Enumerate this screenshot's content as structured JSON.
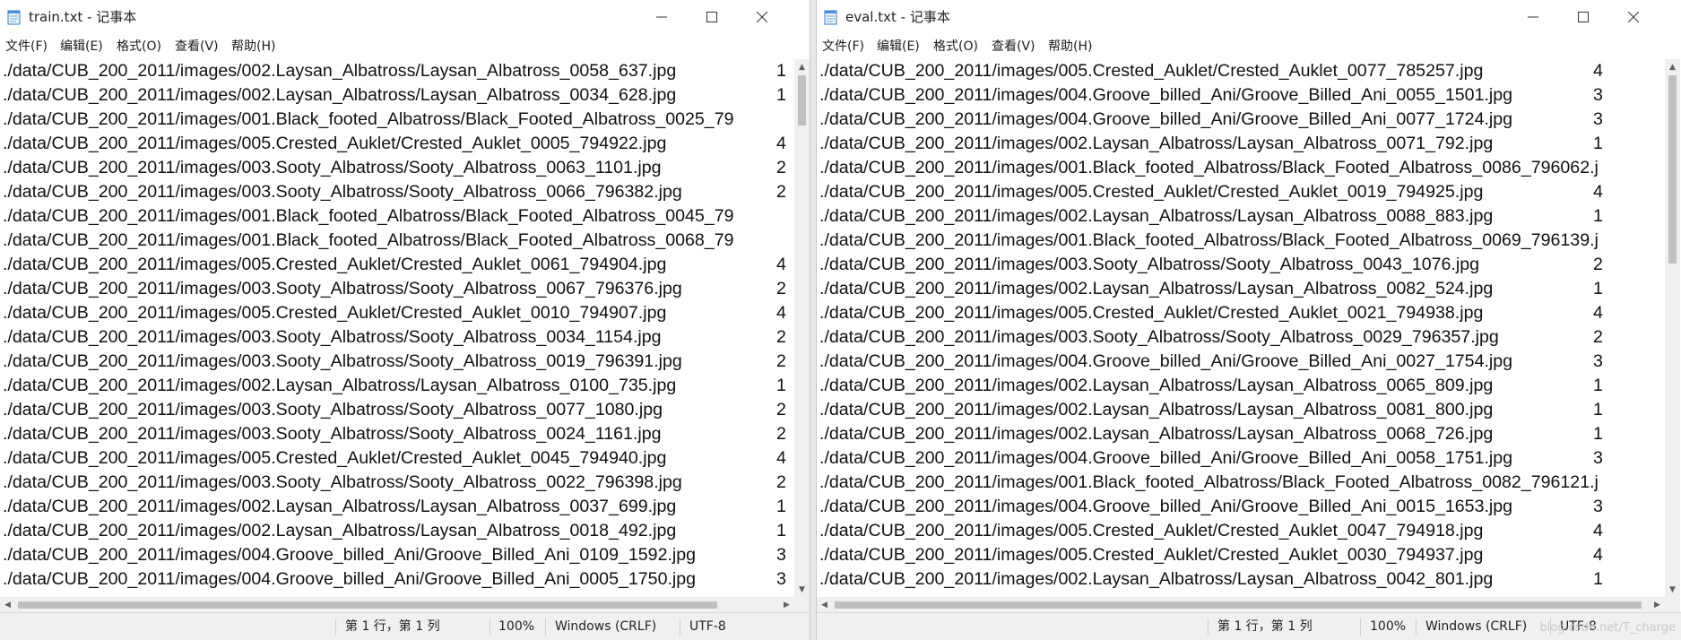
{
  "left": {
    "title": "train.txt - 记事本",
    "menu": [
      "文件(F)",
      "编辑(E)",
      "格式(O)",
      "查看(V)",
      "帮助(H)"
    ],
    "lines": [
      {
        "path": "./data/CUB_200_2011/images/002.Laysan_Albatross/Laysan_Albatross_0058_637.jpg",
        "label": "1"
      },
      {
        "path": "./data/CUB_200_2011/images/002.Laysan_Albatross/Laysan_Albatross_0034_628.jpg",
        "label": "1"
      },
      {
        "path": "./data/CUB_200_2011/images/001.Black_footed_Albatross/Black_Footed_Albatross_0025_79",
        "label": ""
      },
      {
        "path": "./data/CUB_200_2011/images/005.Crested_Auklet/Crested_Auklet_0005_794922.jpg",
        "label": "4"
      },
      {
        "path": "./data/CUB_200_2011/images/003.Sooty_Albatross/Sooty_Albatross_0063_1101.jpg",
        "label": "2"
      },
      {
        "path": "./data/CUB_200_2011/images/003.Sooty_Albatross/Sooty_Albatross_0066_796382.jpg",
        "label": "2"
      },
      {
        "path": "./data/CUB_200_2011/images/001.Black_footed_Albatross/Black_Footed_Albatross_0045_79",
        "label": ""
      },
      {
        "path": "./data/CUB_200_2011/images/001.Black_footed_Albatross/Black_Footed_Albatross_0068_79",
        "label": ""
      },
      {
        "path": "./data/CUB_200_2011/images/005.Crested_Auklet/Crested_Auklet_0061_794904.jpg",
        "label": "4"
      },
      {
        "path": "./data/CUB_200_2011/images/003.Sooty_Albatross/Sooty_Albatross_0067_796376.jpg",
        "label": "2"
      },
      {
        "path": "./data/CUB_200_2011/images/005.Crested_Auklet/Crested_Auklet_0010_794907.jpg",
        "label": "4"
      },
      {
        "path": "./data/CUB_200_2011/images/003.Sooty_Albatross/Sooty_Albatross_0034_1154.jpg",
        "label": "2"
      },
      {
        "path": "./data/CUB_200_2011/images/003.Sooty_Albatross/Sooty_Albatross_0019_796391.jpg",
        "label": "2"
      },
      {
        "path": "./data/CUB_200_2011/images/002.Laysan_Albatross/Laysan_Albatross_0100_735.jpg",
        "label": "1"
      },
      {
        "path": "./data/CUB_200_2011/images/003.Sooty_Albatross/Sooty_Albatross_0077_1080.jpg",
        "label": "2"
      },
      {
        "path": "./data/CUB_200_2011/images/003.Sooty_Albatross/Sooty_Albatross_0024_1161.jpg",
        "label": "2"
      },
      {
        "path": "./data/CUB_200_2011/images/005.Crested_Auklet/Crested_Auklet_0045_794940.jpg",
        "label": "4"
      },
      {
        "path": "./data/CUB_200_2011/images/003.Sooty_Albatross/Sooty_Albatross_0022_796398.jpg",
        "label": "2"
      },
      {
        "path": "./data/CUB_200_2011/images/002.Laysan_Albatross/Laysan_Albatross_0037_699.jpg",
        "label": "1"
      },
      {
        "path": "./data/CUB_200_2011/images/002.Laysan_Albatross/Laysan_Albatross_0018_492.jpg",
        "label": "1"
      },
      {
        "path": "./data/CUB_200_2011/images/004.Groove_billed_Ani/Groove_Billed_Ani_0109_1592.jpg",
        "label": "3"
      },
      {
        "path": "./data/CUB_200_2011/images/004.Groove_billed_Ani/Groove_Billed_Ani_0005_1750.jpg",
        "label": "3"
      }
    ],
    "status": {
      "position": "第 1 行，第 1 列",
      "zoom": "100%",
      "eol": "Windows (CRLF)",
      "encoding": "UTF-8"
    }
  },
  "right": {
    "title": "eval.txt - 记事本",
    "menu": [
      "文件(F)",
      "编辑(E)",
      "格式(O)",
      "查看(V)",
      "帮助(H)"
    ],
    "lines": [
      {
        "path": "./data/CUB_200_2011/images/005.Crested_Auklet/Crested_Auklet_0077_785257.jpg",
        "label": "4"
      },
      {
        "path": "./data/CUB_200_2011/images/004.Groove_billed_Ani/Groove_Billed_Ani_0055_1501.jpg",
        "label": "3"
      },
      {
        "path": "./data/CUB_200_2011/images/004.Groove_billed_Ani/Groove_Billed_Ani_0077_1724.jpg",
        "label": "3"
      },
      {
        "path": "./data/CUB_200_2011/images/002.Laysan_Albatross/Laysan_Albatross_0071_792.jpg",
        "label": "1"
      },
      {
        "path": "./data/CUB_200_2011/images/001.Black_footed_Albatross/Black_Footed_Albatross_0086_796062.j",
        "label": ""
      },
      {
        "path": "./data/CUB_200_2011/images/005.Crested_Auklet/Crested_Auklet_0019_794925.jpg",
        "label": "4"
      },
      {
        "path": "./data/CUB_200_2011/images/002.Laysan_Albatross/Laysan_Albatross_0088_883.jpg",
        "label": "1"
      },
      {
        "path": "./data/CUB_200_2011/images/001.Black_footed_Albatross/Black_Footed_Albatross_0069_796139.j",
        "label": ""
      },
      {
        "path": "./data/CUB_200_2011/images/003.Sooty_Albatross/Sooty_Albatross_0043_1076.jpg",
        "label": "2"
      },
      {
        "path": "./data/CUB_200_2011/images/002.Laysan_Albatross/Laysan_Albatross_0082_524.jpg",
        "label": "1"
      },
      {
        "path": "./data/CUB_200_2011/images/005.Crested_Auklet/Crested_Auklet_0021_794938.jpg",
        "label": "4"
      },
      {
        "path": "./data/CUB_200_2011/images/003.Sooty_Albatross/Sooty_Albatross_0029_796357.jpg",
        "label": "2"
      },
      {
        "path": "./data/CUB_200_2011/images/004.Groove_billed_Ani/Groove_Billed_Ani_0027_1754.jpg",
        "label": "3"
      },
      {
        "path": "./data/CUB_200_2011/images/002.Laysan_Albatross/Laysan_Albatross_0065_809.jpg",
        "label": "1"
      },
      {
        "path": "./data/CUB_200_2011/images/002.Laysan_Albatross/Laysan_Albatross_0081_800.jpg",
        "label": "1"
      },
      {
        "path": "./data/CUB_200_2011/images/002.Laysan_Albatross/Laysan_Albatross_0068_726.jpg",
        "label": "1"
      },
      {
        "path": "./data/CUB_200_2011/images/004.Groove_billed_Ani/Groove_Billed_Ani_0058_1751.jpg",
        "label": "3"
      },
      {
        "path": "./data/CUB_200_2011/images/001.Black_footed_Albatross/Black_Footed_Albatross_0082_796121.j",
        "label": ""
      },
      {
        "path": "./data/CUB_200_2011/images/004.Groove_billed_Ani/Groove_Billed_Ani_0015_1653.jpg",
        "label": "3"
      },
      {
        "path": "./data/CUB_200_2011/images/005.Crested_Auklet/Crested_Auklet_0047_794918.jpg",
        "label": "4"
      },
      {
        "path": "./data/CUB_200_2011/images/005.Crested_Auklet/Crested_Auklet_0030_794937.jpg",
        "label": "4"
      },
      {
        "path": "./data/CUB_200_2011/images/002.Laysan_Albatross/Laysan_Albatross_0042_801.jpg",
        "label": "1"
      }
    ],
    "status": {
      "position": "第 1 行，第 1 列",
      "zoom": "100%",
      "eol": "Windows (CRLF)",
      "encoding": "UTF-8"
    },
    "watermark": "blog.csdn.net/T_charge"
  },
  "icons": {
    "minimize": "minimize-icon",
    "maximize": "maximize-icon",
    "close": "close-icon",
    "notepad": "notepad-icon"
  },
  "colors": {
    "scrollbar_track": "#f0f0f0",
    "scrollbar_thumb": "#c0c0c0",
    "statusbar": "#f0f0f0"
  }
}
